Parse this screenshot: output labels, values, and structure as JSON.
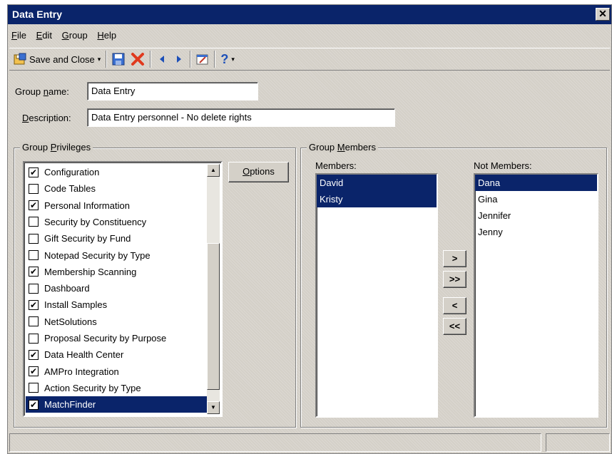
{
  "window": {
    "title": "Data Entry",
    "close": "✕"
  },
  "menu": [
    {
      "pre": "",
      "key": "F",
      "post": "ile"
    },
    {
      "pre": "",
      "key": "E",
      "post": "dit"
    },
    {
      "pre": "",
      "key": "G",
      "post": "roup"
    },
    {
      "pre": "",
      "key": "H",
      "post": "elp"
    }
  ],
  "toolbar": {
    "save_close_label": "Save and Close",
    "dropdown_arrow": "▾",
    "help_glyph": "?"
  },
  "form": {
    "group_name_pre": "Group ",
    "group_name_key": "n",
    "group_name_post": "ame:",
    "group_name_value": "Data Entry",
    "description_pre": "",
    "description_key": "D",
    "description_post": "escription:",
    "description_value": "Data Entry personnel - No delete rights"
  },
  "privileges": {
    "title_pre": "Group ",
    "title_key": "P",
    "title_post": "rivileges",
    "options_key": "O",
    "options_post": "ptions",
    "check_glyph": "✔",
    "items": [
      {
        "label": "Configuration",
        "checked": true
      },
      {
        "label": "Code Tables",
        "checked": false
      },
      {
        "label": "Personal Information",
        "checked": true
      },
      {
        "label": "Security by Constituency",
        "checked": false
      },
      {
        "label": "Gift Security by Fund",
        "checked": false
      },
      {
        "label": "Notepad Security by Type",
        "checked": false
      },
      {
        "label": "Membership Scanning",
        "checked": true
      },
      {
        "label": "Dashboard",
        "checked": false
      },
      {
        "label": "Install Samples",
        "checked": true
      },
      {
        "label": "NetSolutions",
        "checked": false
      },
      {
        "label": "Proposal Security by Purpose",
        "checked": false
      },
      {
        "label": "Data Health Center",
        "checked": true
      },
      {
        "label": "AMPro Integration",
        "checked": true
      },
      {
        "label": "Action Security by Type",
        "checked": false
      },
      {
        "label": "MatchFinder",
        "checked": true,
        "selected": true
      }
    ]
  },
  "members": {
    "title_pre": "Group ",
    "title_key": "M",
    "title_post": "embers",
    "members_label": "Members:",
    "not_members_label": "Not Members:",
    "members": [
      "David",
      "Kristy"
    ],
    "not_members": [
      "Dana",
      "Gina",
      "Jennifer",
      "Jenny"
    ],
    "move_right": ">",
    "move_all_right": ">>",
    "move_left": "<",
    "move_all_left": "<<"
  },
  "colors": {
    "title_bar": "#0a246a",
    "selection": "#0a246a",
    "face": "#d4d0c8",
    "delete_red": "#e03a1e"
  }
}
